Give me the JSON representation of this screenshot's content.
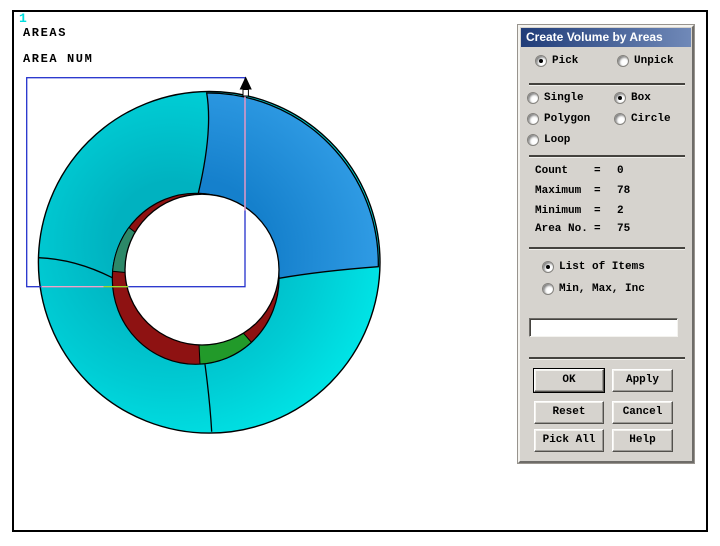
{
  "canvas": {
    "plot_id": "1",
    "annotations": [
      "AREAS",
      "AREA NUM"
    ]
  },
  "dialog": {
    "title": "Create Volume by Areas",
    "pick_radios": [
      {
        "label": "Pick",
        "selected": true
      },
      {
        "label": "Unpick",
        "selected": false
      }
    ],
    "mode_radios": [
      {
        "label": "Single",
        "selected": false
      },
      {
        "label": "Box",
        "selected": true
      },
      {
        "label": "Polygon",
        "selected": false
      },
      {
        "label": "Circle",
        "selected": false
      },
      {
        "label": "Loop",
        "selected": false
      }
    ],
    "stats": [
      {
        "label": "Count",
        "eq": "=",
        "value": "0"
      },
      {
        "label": "Maximum",
        "eq": "=",
        "value": "78"
      },
      {
        "label": "Minimum",
        "eq": "=",
        "value": "2"
      },
      {
        "label": "Area No.",
        "eq": "=",
        "value": "75"
      }
    ],
    "list_radios": [
      {
        "label": "List of Items",
        "selected": true
      },
      {
        "label": "Min, Max, Inc",
        "selected": false
      }
    ],
    "input": {
      "value": "",
      "placeholder": ""
    },
    "buttons": [
      {
        "label": "OK",
        "default": true
      },
      {
        "label": "Apply"
      },
      {
        "label": "Reset"
      },
      {
        "label": "Cancel"
      },
      {
        "label": "Pick All"
      },
      {
        "label": "Help"
      }
    ]
  },
  "colors": {
    "cyan_bright": "#00ecec",
    "cyan_dark": "#00b2c0",
    "blue_bright": "#38a4ec",
    "blue_dark": "#1580cc",
    "red": "#8e1212",
    "green": "#229a2a",
    "teal": "#2c8868",
    "box_blue": "#2330cc",
    "xor_pink": "#f2a4c6",
    "xor_green": "#a0d828",
    "label_cyan": "#00dfdf",
    "titlebar_left": "#203c78",
    "titlebar_right": "#7089b8"
  }
}
